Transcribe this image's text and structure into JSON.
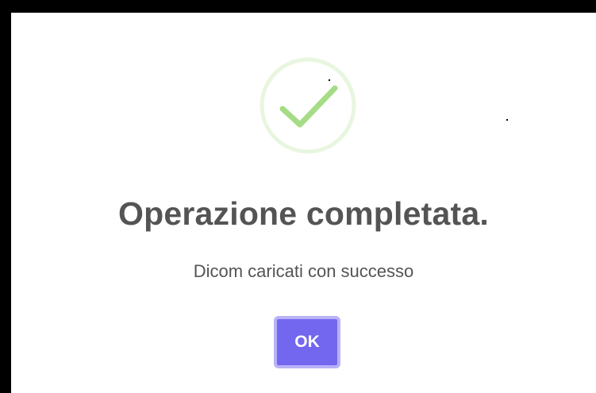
{
  "dialog": {
    "icon": "check-circle-icon",
    "title": "Operazione completata.",
    "message": "Dicom caricati con successo",
    "ok_label": "OK"
  },
  "colors": {
    "success_green": "#a5dc86",
    "success_ring": "#e8f6df",
    "text": "#545454",
    "button": "#7367f0",
    "button_focus_ring": "#b8b2f7",
    "background": "#ffffff"
  }
}
